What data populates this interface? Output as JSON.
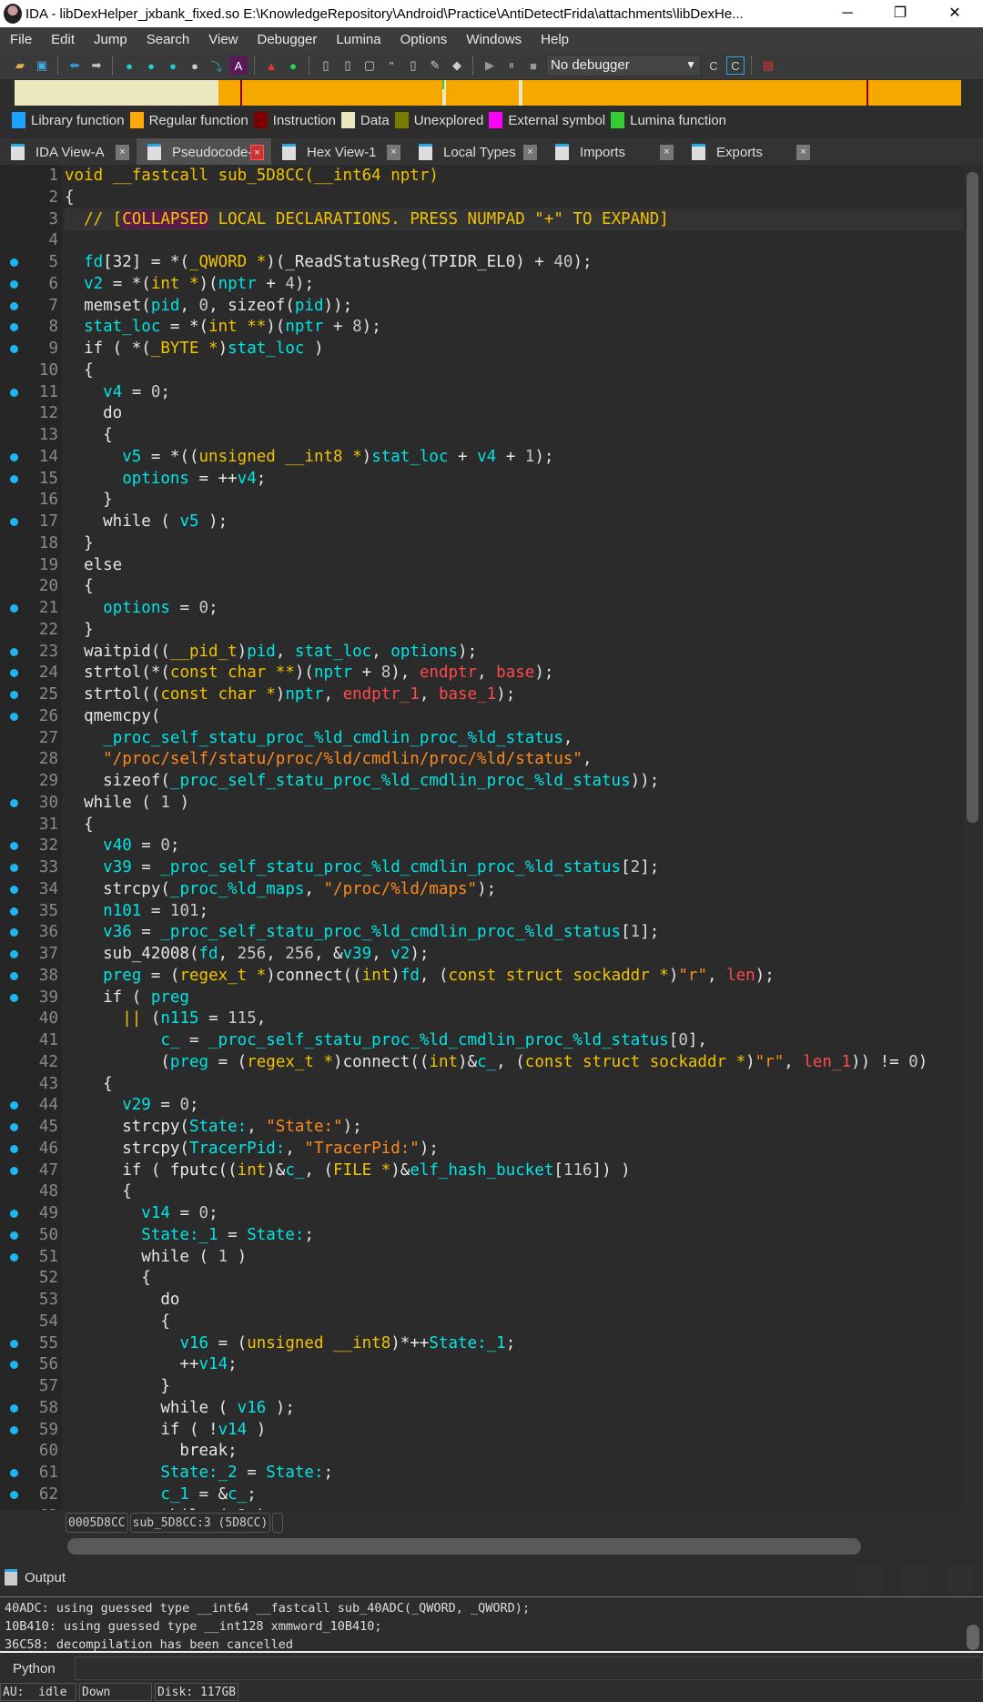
{
  "window": {
    "title": "IDA - libDexHelper_jxbank_fixed.so E:\\KnowledgeRepository\\Android\\Practice\\AntiDetectFrida\\attachments\\libDexHe...",
    "minimize": "─",
    "restore": "❐",
    "close": "✕"
  },
  "menu": [
    "File",
    "Edit",
    "Jump",
    "Search",
    "View",
    "Debugger",
    "Lumina",
    "Options",
    "Windows",
    "Help"
  ],
  "toolbar": {
    "debugger_select": "No debugger"
  },
  "legend": [
    {
      "label": "Library function",
      "color": "#1aa3ff"
    },
    {
      "label": "Regular function",
      "color": "#ffaa00"
    },
    {
      "label": "Instruction",
      "color": "#800000"
    },
    {
      "label": "Data",
      "color": "#ebe8bf"
    },
    {
      "label": "Unexplored",
      "color": "#7a7a00"
    },
    {
      "label": "External symbol",
      "color": "#ff00ff"
    },
    {
      "label": "Lumina function",
      "color": "#33cc33"
    }
  ],
  "tabs": [
    {
      "label": "IDA View-A"
    },
    {
      "label": "Pseudocode-A",
      "active": true
    },
    {
      "label": "Hex View-1"
    },
    {
      "label": "Local Types"
    },
    {
      "label": "Imports"
    },
    {
      "label": "Exports"
    }
  ],
  "code": {
    "dots": [
      5,
      6,
      7,
      8,
      9,
      11,
      14,
      15,
      17,
      21,
      23,
      24,
      25,
      26,
      30,
      32,
      33,
      34,
      35,
      36,
      37,
      38,
      39,
      44,
      45,
      46,
      47,
      49,
      50,
      51,
      55,
      56,
      58,
      59,
      61,
      62
    ],
    "lines": [
      "{t:void __fastcall sub_5D8CC(__int64 nptr)}",
      "{",
      "  {c:// [}{p:COLLAPSED}{c: LOCAL DECLARATIONS. PRESS NUMPAD \"+\" TO EXPAND]}",
      "",
      "  {v:fd}[32] = *({t:_QWORD *})(_ReadStatusReg(TPIDR_EL0) + {n:40});",
      "  {v:v2} = *({t:int *})({v:nptr} + {n:4});",
      "  memset({v:pid}, {n:0}, sizeof({v:pid}));",
      "  {v:stat_loc} = *({t:int **})({v:nptr} + {n:8});",
      "  if ( *({t:_BYTE *}){v:stat_loc} )",
      "  {",
      "    {v:v4} = {n:0};",
      "    do",
      "    {",
      "      {v:v5} = *(({t:unsigned __int8 *}){v:stat_loc} + {v:v4} + {n:1});",
      "      {v:options} = ++{v:v4};",
      "    }",
      "    while ( {v:v5} );",
      "  }",
      "  else",
      "  {",
      "    {v:options} = {n:0};",
      "  }",
      "  waitpid(({t:__pid_t}){v:pid}, {v:stat_loc}, {v:options});",
      "  strtol(*({t:const char **})({v:nptr} + {n:8}), {r:endptr}, {r:base});",
      "  strtol(({t:const char *}){v:nptr}, {r:endptr_1}, {r:base_1});",
      "  qmemcpy(",
      "    {v:_proc_self_statu_proc_%ld_cmdlin_proc_%ld_status},",
      "    {s:\"/proc/self/statu/proc/%ld/cmdlin/proc/%ld/status\"},",
      "    sizeof({v:_proc_self_statu_proc_%ld_cmdlin_proc_%ld_status}));",
      "  while ( {n:1} )",
      "  {",
      "    {v:v40} = {n:0};",
      "    {v:v39} = {v:_proc_self_statu_proc_%ld_cmdlin_proc_%ld_status}[{n:2}];",
      "    strcpy({v:_proc_%ld_maps}, {s:\"/proc/%ld/maps\"});",
      "    {v:n101} = {n:101};",
      "    {v:v36} = {v:_proc_self_statu_proc_%ld_cmdlin_proc_%ld_status}[{n:1}];",
      "    sub_42008({v:fd}, {n:256}, {n:256}, &{v:v39}, {v:v2});",
      "    {v:preg} = ({t:regex_t *})connect(({t:int}){v:fd}, ({t:const struct sockaddr *}){s:\"r\"}, {r:len});",
      "    if ( {v:preg}",
      "      {t:||} ({v:n115} = {n:115},",
      "          {v:c_} = {v:_proc_self_statu_proc_%ld_cmdlin_proc_%ld_status}[{n:0}],",
      "          ({v:preg} = ({t:regex_t *})connect(({t:int})&{v:c_}, ({t:const struct sockaddr *}){s:\"r\"}, {r:len_1})) != {n:0})",
      "    {",
      "      {v:v29} = {n:0};",
      "      strcpy({v:State:}, {s:\"State:\"});",
      "      strcpy({v:TracerPid:}, {s:\"TracerPid:\"});",
      "      if ( fputc(({t:int})&{v:c_}, ({t:FILE *})&{v:elf_hash_bucket}[{n:116}]) )",
      "      {",
      "        {v:v14} = {n:0};",
      "        {v:State:_1} = {v:State:};",
      "        while ( {n:1} )",
      "        {",
      "          do",
      "          {",
      "            {v:v16} = ({t:unsigned __int8})*++{v:State:_1};",
      "            ++{v:v14};",
      "          }",
      "          while ( {v:v16} );",
      "          if ( !{v:v14} )",
      "            break;",
      "          {v:State:_2} = {v:State:};",
      "          {v:c_1} = &{v:c_};",
      "          while ( {n:1} )"
    ]
  },
  "status_pills": [
    "0005D8CC",
    "sub_5D8CC:3 (5D8CC)",
    ""
  ],
  "output": {
    "title": "Output",
    "lines": [
      "40ADC: using guessed type __int64 __fastcall sub_40ADC(_QWORD, _QWORD);",
      "10B410: using guessed type __int128 xmmword_10B410;",
      "36C58: decompilation has been cancelled"
    ]
  },
  "python": {
    "label": "Python",
    "value": ""
  },
  "statusbar": [
    "AU:  idle",
    "Down    ",
    "Disk: 117GB"
  ]
}
